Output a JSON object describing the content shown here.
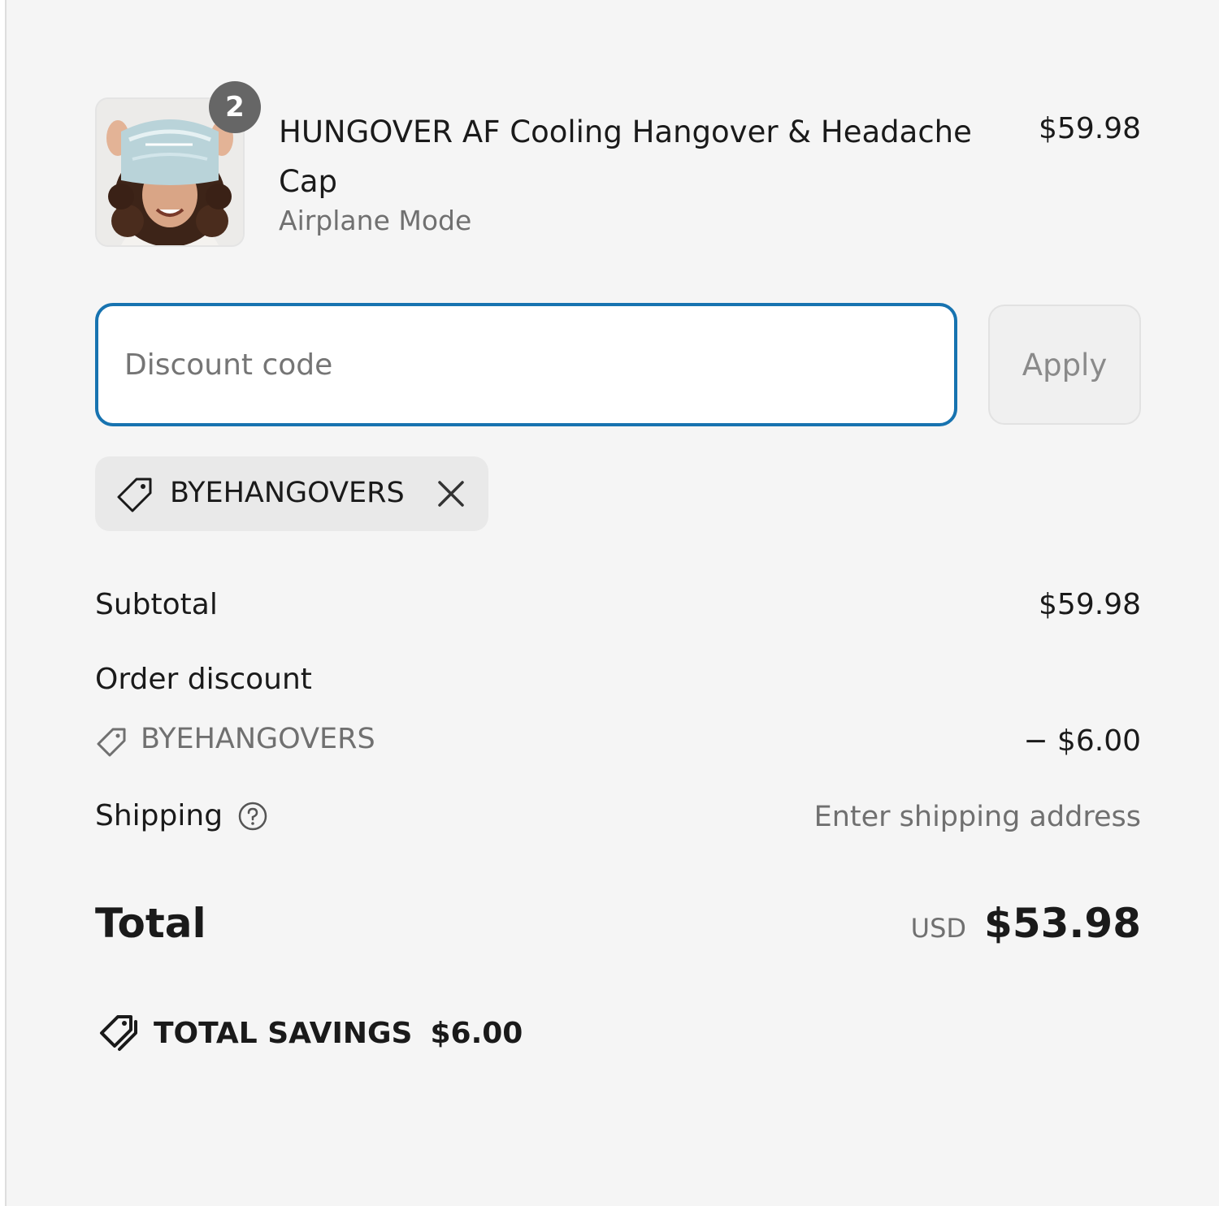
{
  "line_item": {
    "quantity": "2",
    "title": "HUNGOVER AF Cooling Hangover & Headache Cap",
    "variant": "Airplane Mode",
    "price": "$59.98",
    "image_icon": "product-photo-cap"
  },
  "discount": {
    "placeholder": "Discount code",
    "value": "",
    "apply_label": "Apply",
    "applied_code": "BYEHANGOVERS",
    "tag_icon": "tag-icon",
    "remove_icon": "close-icon"
  },
  "summary": {
    "subtotal_label": "Subtotal",
    "subtotal_value": "$59.98",
    "order_discount_label": "Order discount",
    "discount_code": "BYEHANGOVERS",
    "discount_amount": "− $6.00",
    "shipping_label": "Shipping",
    "shipping_value": "Enter shipping address"
  },
  "total": {
    "label": "Total",
    "currency": "USD",
    "amount": "$53.98"
  },
  "savings": {
    "label": "TOTAL SAVINGS",
    "amount": "$6.00"
  },
  "colors": {
    "background": "#f5f5f5",
    "focus_border": "#1773b0",
    "muted_text": "#707070",
    "badge": "#666666"
  }
}
